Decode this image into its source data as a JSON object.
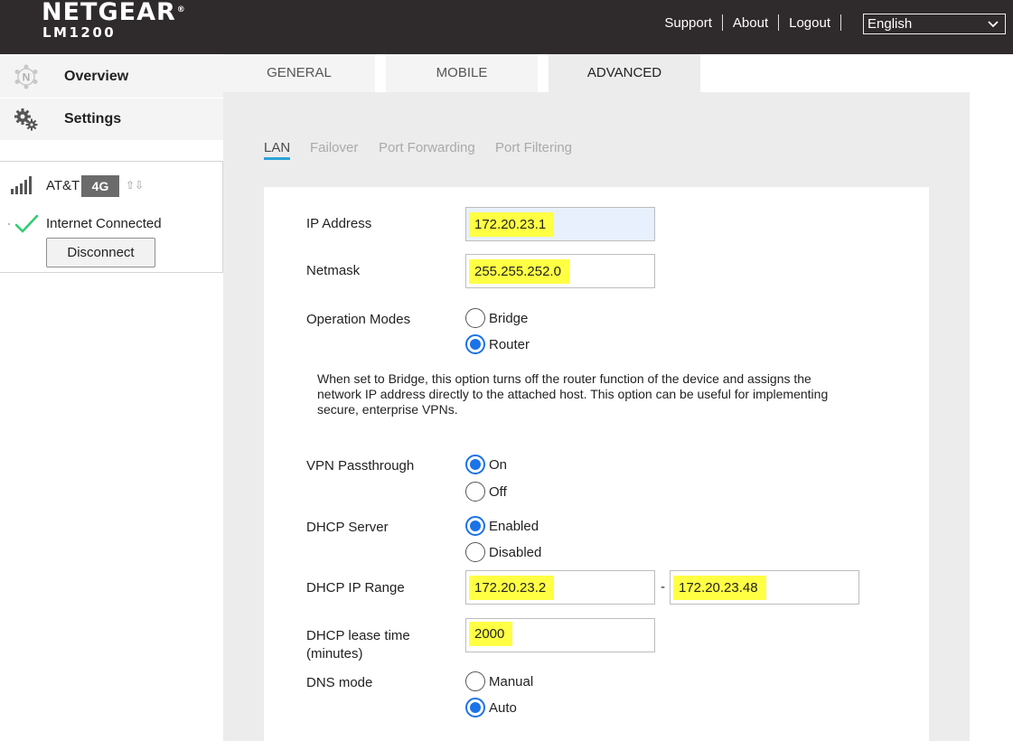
{
  "header": {
    "brand": "NETGEAR",
    "model": "LM1200",
    "links": {
      "support": "Support",
      "about": "About",
      "logout": "Logout"
    },
    "language": "English"
  },
  "sidebar": {
    "overview": "Overview",
    "settings": "Settings",
    "status": {
      "carrier": "AT&T",
      "network_type": "4G",
      "connection": "Internet Connected",
      "disconnect_label": "Disconnect"
    }
  },
  "tabs": {
    "general": "GENERAL",
    "mobile": "MOBILE",
    "advanced": "ADVANCED"
  },
  "subtabs": {
    "lan": "LAN",
    "failover": "Failover",
    "port_forwarding": "Port Forwarding",
    "port_filtering": "Port Filtering"
  },
  "form": {
    "ip_address": {
      "label": "IP Address",
      "value": "172.20.23.1"
    },
    "netmask": {
      "label": "Netmask",
      "value": "255.255.252.0"
    },
    "operation_modes": {
      "label": "Operation Modes",
      "bridge": "Bridge",
      "router": "Router",
      "selected": "Router"
    },
    "note": "When set to Bridge, this option turns off the router function of the device and assigns the network IP address directly to the attached host. This option can be useful for implementing secure, enterprise VPNs.",
    "vpn_passthrough": {
      "label": "VPN Passthrough",
      "on": "On",
      "off": "Off",
      "selected": "On"
    },
    "dhcp_server": {
      "label": "DHCP Server",
      "enabled": "Enabled",
      "disabled": "Disabled",
      "selected": "Enabled"
    },
    "dhcp_range": {
      "label": "DHCP IP Range",
      "start": "172.20.23.2",
      "end": "172.20.23.48",
      "separator": "-"
    },
    "lease_time": {
      "label_line1": "DHCP lease time",
      "label_line2": "(minutes)",
      "value": "2000"
    },
    "dns_mode": {
      "label": "DNS mode",
      "manual": "Manual",
      "auto": "Auto",
      "selected": "Auto"
    }
  },
  "colors": {
    "header_bg": "#2f2a2b",
    "accent_blue": "#1a73e8",
    "subtab_underline": "#2aa4d8",
    "highlight": "#ffff44",
    "check_green": "#2ecc71"
  }
}
